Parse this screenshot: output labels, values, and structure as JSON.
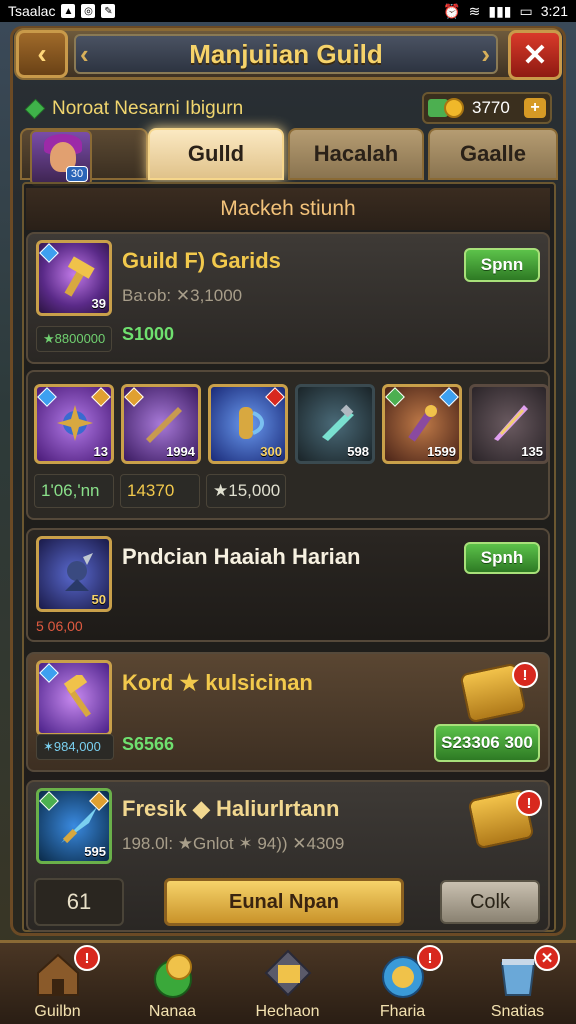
{
  "status_bar": {
    "carrier": "Tsaalac",
    "time": "3:21"
  },
  "header": {
    "title": "Manjuiian Guild",
    "back_arrow": "‹",
    "close_glyph": "✕"
  },
  "subheader": {
    "label": "Noroat Nesarni Ibigurn",
    "currency_value": "3770",
    "plus": "+"
  },
  "avatar": {
    "level": "30"
  },
  "tabs": [
    "Gulld",
    "Hacalah",
    "Gaalle"
  ],
  "active_tab": 0,
  "section_title": "Mackeh stiunh",
  "guild_card": {
    "title": "Guild F) Garids",
    "subtitle": "Ba:ob: ✕3,1000",
    "chip": "★8800000",
    "green_value": "S1000",
    "button": "Spnn",
    "icon_num": "39"
  },
  "items_grid": {
    "items": [
      {
        "num": "13",
        "color": "#6a2aa0"
      },
      {
        "num": "1994",
        "color": "#5a2a88"
      },
      {
        "num": "300",
        "color": "#3050b0"
      },
      {
        "num": "598",
        "color": "#2a3a48"
      },
      {
        "num": "1599",
        "color": "#5a3a30"
      },
      {
        "num": "135",
        "color": "#3a3038"
      }
    ],
    "stats": [
      "1ʹ06,ʹnn",
      "14370",
      "★15,000"
    ]
  },
  "daily_card": {
    "title": "Pndcian Haaiah Harian",
    "button": "Spnh",
    "sub": "5 06,00",
    "icon_num": "50"
  },
  "gold_card": {
    "title": "Kord ★ kulsicinan",
    "chip": "✶984,000",
    "green_value": "S6566",
    "button": "S23306 300",
    "badge": "!"
  },
  "reward_card": {
    "title": "Fresik ◆ Haliurlrtann",
    "sub": "198.0l: ★Gnlot ✶ 94)) ✕4309",
    "icon_num": "595",
    "badge": "!"
  },
  "bottom_controls": {
    "qty": "61",
    "primary": "Eunal Npan",
    "secondary": "Colk"
  },
  "bottom_nav": [
    {
      "label": "Guilbn",
      "icon": "house-icon",
      "badge": "!"
    },
    {
      "label": "Nanaa",
      "icon": "coin-orb-icon",
      "badge": ""
    },
    {
      "label": "Hechaon",
      "icon": "anvil-icon",
      "badge": ""
    },
    {
      "label": "Fharia",
      "icon": "sun-token-icon",
      "badge": "!"
    },
    {
      "label": "Snatias",
      "icon": "bucket-icon",
      "badge": "✕"
    }
  ]
}
